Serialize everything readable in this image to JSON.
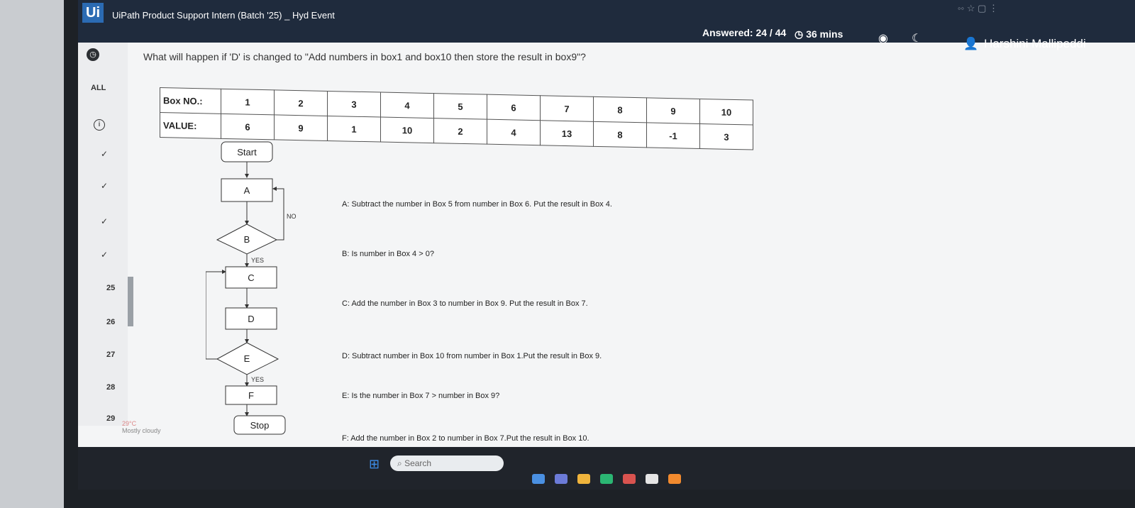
{
  "header": {
    "logo": "Ui",
    "title": "UiPath Product Support Intern (Batch '25) _ Hyd Event",
    "answered": "Answered: 24 / 44",
    "timer": "36 mins",
    "user": "Harshini Mallipeddi"
  },
  "nav": {
    "all": "ALL",
    "numbers": [
      "25",
      "26",
      "27",
      "28",
      "29"
    ]
  },
  "question": "What will happen if 'D' is changed to \"Add numbers in box1 and box10 then store the result in box9\"?",
  "table": {
    "header_label": "Box NO.:",
    "value_label": "VALUE:",
    "box_numbers": [
      "1",
      "2",
      "3",
      "4",
      "5",
      "6",
      "7",
      "8",
      "9",
      "10"
    ],
    "values": [
      "6",
      "9",
      "1",
      "10",
      "2",
      "4",
      "13",
      "8",
      "-1",
      "3"
    ]
  },
  "flowchart": {
    "start": "Start",
    "stop": "Stop",
    "nodes": {
      "a": "A",
      "b": "B",
      "c": "C",
      "d": "D",
      "e": "E",
      "f": "F"
    },
    "yes": "YES",
    "no": "NO"
  },
  "descriptions": {
    "a": "A: Subtract the number in Box 5 from number in Box 6. Put the result in Box 4.",
    "b": "B: Is number in Box 4 > 0?",
    "c": "C: Add the number in Box 3 to number in Box 9. Put the result in Box 7.",
    "d": "D: Subtract number in Box 10 from number in Box 1.Put the result in Box 9.",
    "e": "E: Is the number in Box 7 > number in Box 9?",
    "f": "F: Add the number in Box 2 to number in Box 7.Put the result in Box 10."
  },
  "weather": {
    "temp": "29°C",
    "condition": "Mostly cloudy"
  },
  "taskbar": {
    "search_placeholder": "Search"
  }
}
